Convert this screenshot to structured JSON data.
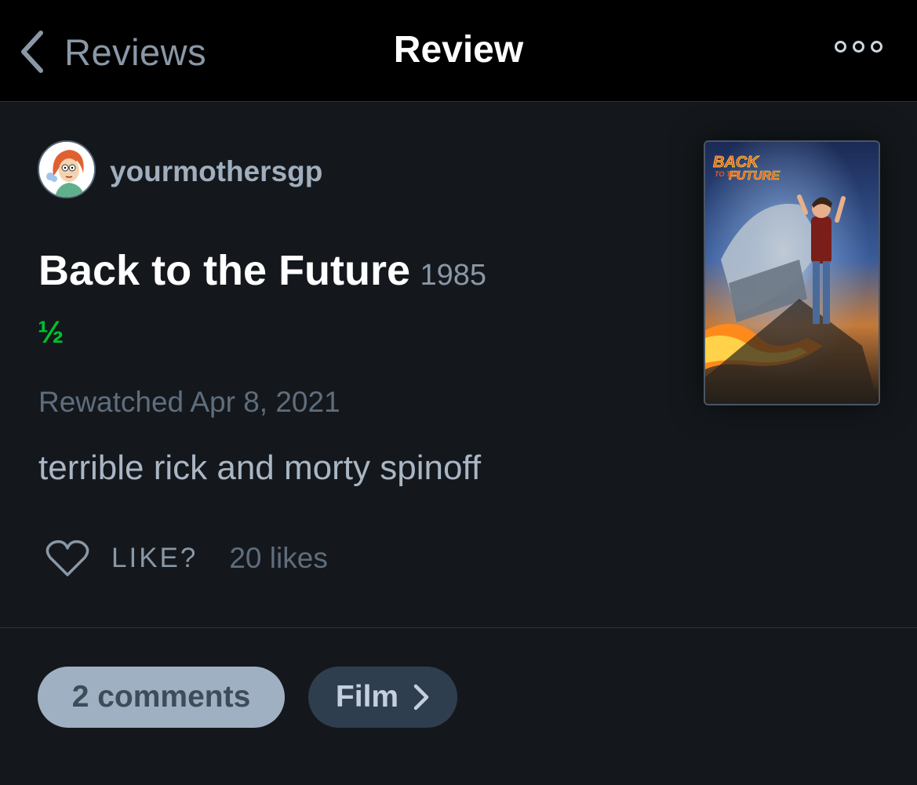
{
  "nav": {
    "back_label": "Reviews",
    "title": "Review"
  },
  "review": {
    "username": "yourmothersgp",
    "film_title": "Back to the Future",
    "film_year": "1985",
    "rating": "½",
    "rating_value": 0.5,
    "watched": "Rewatched Apr 8, 2021",
    "text": "terrible rick and morty spinoff",
    "like_label": "LIKE?",
    "likes_count": "20 likes",
    "poster": {
      "title_line1": "BACK",
      "title_line2": "TO THE",
      "title_line3": "FUTURE"
    }
  },
  "footer": {
    "comments_label": "2 comments",
    "film_label": "Film"
  },
  "colors": {
    "background": "#14181c",
    "topbar": "#000000",
    "rating_green": "#00c030",
    "pill_light": "#9fb0c2",
    "pill_dark": "#2f3e4e"
  },
  "icons": {
    "back": "chevron-left-icon",
    "more": "more-dots-icon",
    "like": "heart-outline-icon",
    "film_arrow": "chevron-right-icon"
  }
}
